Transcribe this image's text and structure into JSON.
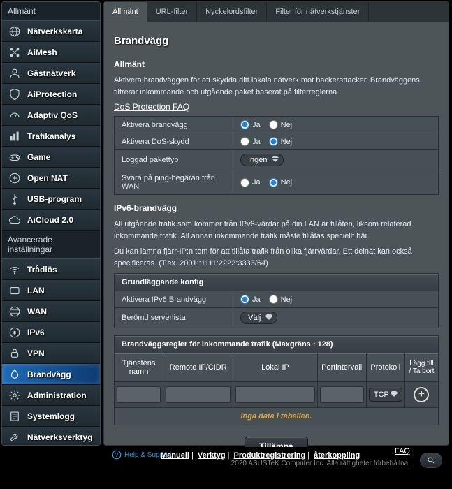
{
  "sidebar": {
    "section_general": "Allmänt",
    "section_advanced": "Avancerade inställningar",
    "items_general": [
      {
        "label": "Nätverkskarta",
        "icon": "globe"
      },
      {
        "label": "AiMesh",
        "icon": "mesh"
      },
      {
        "label": "Gästnätverk",
        "icon": "guest"
      },
      {
        "label": "AiProtection",
        "icon": "shield"
      },
      {
        "label": "Adaptiv QoS",
        "icon": "gauge"
      },
      {
        "label": "Trafikanalys",
        "icon": "stats"
      },
      {
        "label": "Game",
        "icon": "gamepad"
      },
      {
        "label": "Open NAT",
        "icon": "nat"
      },
      {
        "label": "USB-program",
        "icon": "usb"
      },
      {
        "label": "AiCloud 2.0",
        "icon": "cloud"
      }
    ],
    "items_advanced": [
      {
        "label": "Trådlös",
        "icon": "wifi"
      },
      {
        "label": "LAN",
        "icon": "lan"
      },
      {
        "label": "WAN",
        "icon": "wan"
      },
      {
        "label": "IPv6",
        "icon": "ipv6"
      },
      {
        "label": "VPN",
        "icon": "vpn"
      },
      {
        "label": "Brandvägg",
        "icon": "firewall",
        "active": true
      },
      {
        "label": "Administration",
        "icon": "gear"
      },
      {
        "label": "Systemlogg",
        "icon": "log"
      },
      {
        "label": "Nätverksverktyg",
        "icon": "tools"
      }
    ]
  },
  "tabs": [
    {
      "label": "Allmänt",
      "active": true
    },
    {
      "label": "URL-filter"
    },
    {
      "label": "Nyckelordsfilter"
    },
    {
      "label": "Filter för nätverkstjänster"
    }
  ],
  "page": {
    "title": "Brandvägg",
    "general_heading": "Allmänt",
    "general_desc": "Aktivera brandväggen för att skydda ditt lokala nätverk mot hackerattacker. Brandväggens filtrerar inkommande och utgående paket baserat på filterreglerna.",
    "dos_faq": "DoS Protection FAQ",
    "rows": {
      "enable_fw": "Aktivera brandvägg",
      "enable_dos": "Aktivera DoS-skydd",
      "log_type": "Loggad pakettyp",
      "ping_wan": "Svara på ping-begäran från WAN"
    },
    "yes": "Ja",
    "no": "Nej",
    "log_select": "Ingen",
    "ipv6_heading": "IPv6-brandvägg",
    "ipv6_desc1": "All utgående trafik som kommer från IPv6-värdar på din LAN är tillåten, liksom relaterad inkommande trafik. All annan inkommande trafik måste tillåtas speciellt här.",
    "ipv6_desc2": "Du kan lämna fjärr-IP:n tom för att tillåta trafik från olika fjärrvärdar. Ett delnät kan också specificeras. (T.ex. 2001::1111:2222:3333/64)",
    "basic_config": "Grundläggande konfig",
    "enable_ipv6_fw": "Aktivera IPv6 Brandvägg",
    "famous_list": "Berömd serverlista",
    "famous_select": "Välj",
    "rules_title": "Brandväggsregler för inkommande trafik (Maxgräns : 128)",
    "cols": {
      "service": "Tjänstens namn",
      "remote": "Remote IP/CIDR",
      "local": "Lokal IP",
      "port": "Portintervall",
      "proto": "Protokoll",
      "action": "Lägg till / Ta bort"
    },
    "proto_default": "TCP",
    "no_data": "Inga data i tabellen.",
    "apply": "Tillämpa"
  },
  "footer": {
    "help": "Help & Support",
    "links": [
      "Manuell",
      "Verktyg",
      "Produktregistrering",
      "återkoppling"
    ],
    "faq": "FAQ",
    "copyright": "2020 ASUSTeK Computer Inc. Alla rättigheter förbehållna."
  }
}
